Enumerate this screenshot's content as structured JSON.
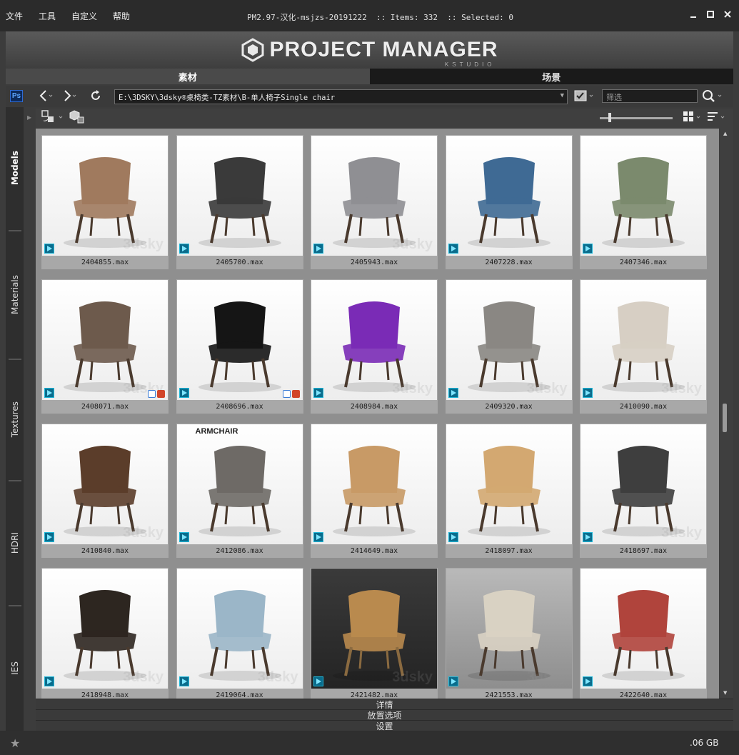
{
  "menu": [
    "文件",
    "工具",
    "自定义",
    "帮助"
  ],
  "window": {
    "title": "PM2.97-汉化-msjzs-20191222  :: Items: 332  :: Selected: 0",
    "buttons": [
      "minimize",
      "maximize",
      "close"
    ]
  },
  "banner": {
    "logo_text": "PROJECT MANAGER",
    "logo_sub": "KSTUDIO"
  },
  "tabs": [
    {
      "label": "素材",
      "active": true
    },
    {
      "label": "场景",
      "active": false
    }
  ],
  "toolbar": {
    "ps_label": "Ps",
    "path": "E:\\3DSKY\\3dsky®桌椅类-TZ素材\\B-单人椅子Single chair",
    "filter_placeholder": "筛选"
  },
  "sidebar": [
    {
      "label": "Models",
      "active": true
    },
    {
      "label": "Materials",
      "active": false
    },
    {
      "label": "Textures",
      "active": false
    },
    {
      "label": "HDRI",
      "active": false
    },
    {
      "label": "IES",
      "active": false
    }
  ],
  "items": [
    {
      "name": "2404855.max",
      "bg": "light",
      "color": "#a07a5e",
      "wm": "3dsky",
      "render_badges": false
    },
    {
      "name": "2405700.max",
      "bg": "light",
      "color": "#3a3a3a",
      "wm": "",
      "render_badges": false
    },
    {
      "name": "2405943.max",
      "bg": "light",
      "color": "#8f8f93",
      "wm": "3dsky",
      "render_badges": false
    },
    {
      "name": "2407228.max",
      "bg": "light",
      "color": "#3f6a94",
      "wm": "",
      "render_badges": false
    },
    {
      "name": "2407346.max",
      "bg": "light",
      "color": "#7b8a6d",
      "wm": "",
      "render_badges": false
    },
    {
      "name": "2408071.max",
      "bg": "light",
      "color": "#6d5a4c",
      "wm": "3dsky",
      "render_badges": true
    },
    {
      "name": "2408696.max",
      "bg": "light",
      "color": "#151515",
      "wm": "",
      "render_badges": true
    },
    {
      "name": "2408984.max",
      "bg": "light",
      "color": "#7a2bb6",
      "wm": "3dsky",
      "render_badges": false
    },
    {
      "name": "2409320.max",
      "bg": "light",
      "color": "#8a8783",
      "wm": "3dsky",
      "render_badges": false
    },
    {
      "name": "2410090.max",
      "bg": "light",
      "color": "#d7cfc4",
      "wm": "3dsky",
      "render_badges": false
    },
    {
      "name": "2410840.max",
      "bg": "light",
      "color": "#5b3d2a",
      "wm": "3dsky",
      "render_badges": false
    },
    {
      "name": "2412086.max",
      "bg": "light",
      "color": "#6e6a66",
      "wm": "",
      "render_badges": false,
      "caption": "ARMCHAIR"
    },
    {
      "name": "2414649.max",
      "bg": "light",
      "color": "#c89a66",
      "wm": "",
      "render_badges": false
    },
    {
      "name": "2418097.max",
      "bg": "light",
      "color": "#d3a871",
      "wm": "",
      "render_badges": false
    },
    {
      "name": "2418697.max",
      "bg": "light",
      "color": "#3e3e3e",
      "wm": "3dsky",
      "render_badges": false
    },
    {
      "name": "2418948.max",
      "bg": "light",
      "color": "#2d2620",
      "wm": "3dsky",
      "render_badges": false
    },
    {
      "name": "2419064.max",
      "bg": "light",
      "color": "#9bb6c8",
      "wm": "3dsky",
      "render_badges": false
    },
    {
      "name": "2421482.max",
      "bg": "dark",
      "color": "#b98a4e",
      "wm": "3dsky",
      "render_badges": false
    },
    {
      "name": "2421553.max",
      "bg": "gray",
      "color": "#d9d2c3",
      "wm": "3dsky",
      "render_badges": false
    },
    {
      "name": "2422640.max",
      "bg": "light",
      "color": "#b0443c",
      "wm": "",
      "render_badges": false
    }
  ],
  "bottom_panels": [
    "详情",
    "放置选项",
    "设置"
  ],
  "status": {
    "disk_space": ".06 GB"
  }
}
